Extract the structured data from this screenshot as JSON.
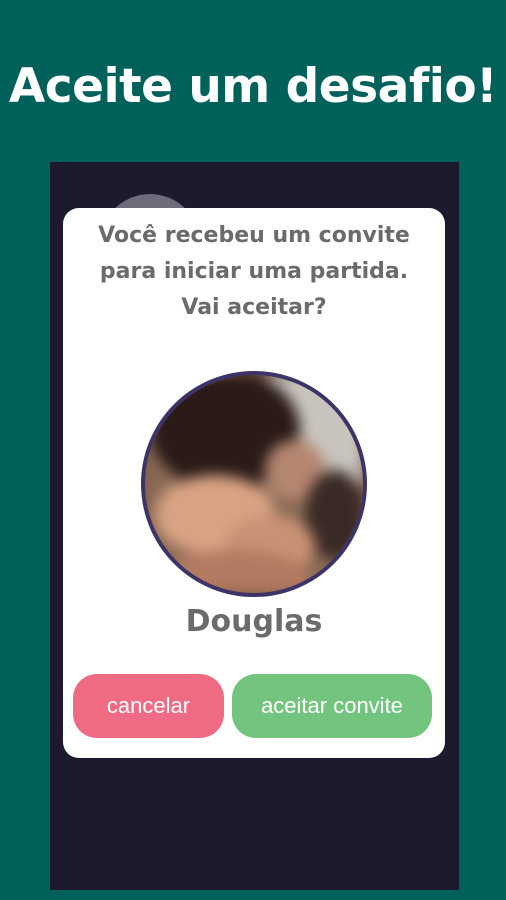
{
  "promo": {
    "title": "Aceite um desafio!"
  },
  "dialog": {
    "message_line1": "Você recebeu um convite",
    "message_line2": "para iniciar uma partida.",
    "message_line3": "Vai aceitar?",
    "opponent_name": "Douglas",
    "cancel_label": "cancelar",
    "accept_label": "aceitar convite"
  },
  "colors": {
    "background": "#00615a",
    "screen": "#1c1a2c",
    "cancel": "#ef6b84",
    "accept": "#72c47e",
    "text": "#6b6b6b",
    "avatar_ring": "#3c3468"
  }
}
